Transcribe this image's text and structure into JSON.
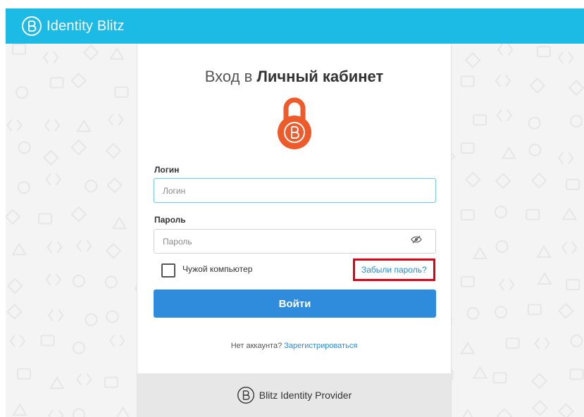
{
  "header": {
    "brand_name": "Identity Blitz",
    "bg_color": "#1bbbe6",
    "icon": "blitz-logo-icon"
  },
  "login_form": {
    "title_prefix": "Вход в",
    "title_emphasis": "Личный кабинет",
    "lock_icon": "padlock-logo-icon",
    "lock_color": "#ef5a2b",
    "login": {
      "label": "Логин",
      "placeholder": "Логин",
      "value": ""
    },
    "password": {
      "label": "Пароль",
      "placeholder": "Пароль",
      "value": "",
      "toggle_icon": "eye-slash-icon"
    },
    "remember": {
      "label": "Чужой компьютер",
      "checked": false
    },
    "forgot_link": "Забыли пароль?",
    "submit_label": "Войти",
    "submit_color": "#2f8bdc",
    "signup_prompt": "Нет аккаунта?",
    "signup_link": "Зарегистрироваться"
  },
  "footer": {
    "text": "Blitz Identity Provider",
    "icon": "blitz-logo-icon"
  },
  "annotation": {
    "highlight_color": "#e20016"
  }
}
